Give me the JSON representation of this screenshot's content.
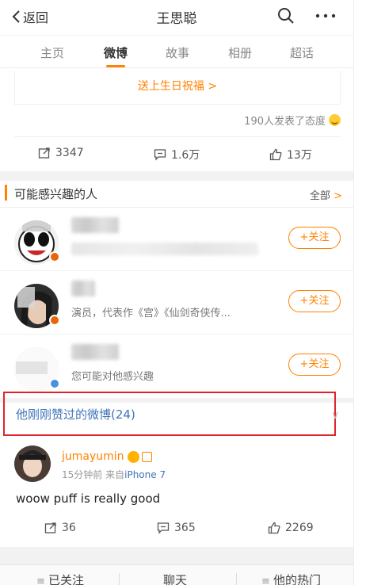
{
  "nav": {
    "back_label": "返回",
    "title": "王思聪"
  },
  "tabs": [
    {
      "label": "主页"
    },
    {
      "label": "微博"
    },
    {
      "label": "故事"
    },
    {
      "label": "相册"
    },
    {
      "label": "超话"
    }
  ],
  "birthday": {
    "label": "送上生日祝福 >"
  },
  "attitude": {
    "text": "190人发表了态度"
  },
  "actions": {
    "repost": "3347",
    "comment": "1.6万",
    "like": "13万"
  },
  "people": {
    "title": "可能感兴趣的人",
    "all_label": "全部",
    "all_arrow": ">",
    "items": [
      {
        "desc": "",
        "follow_label": "+关注",
        "badge_color": "#e8650a"
      },
      {
        "desc": "演员，代表作《宫》《仙剑奇侠传...",
        "follow_label": "+关注",
        "badge_color": "#e8650a"
      },
      {
        "desc": "您可能对他感兴趣",
        "follow_label": "+关注",
        "badge_color": "#4a90e2"
      }
    ]
  },
  "liked": {
    "title": "他刚刚赞过的微博(24)",
    "chevron": "∨"
  },
  "post": {
    "username": "jumayumin",
    "time": "15分钟前",
    "source_prefix": "来自",
    "source": "iPhone 7",
    "text": "woow puff is really good",
    "repost": "36",
    "comment": "365",
    "like": "2269"
  },
  "bottom": {
    "followed": "已关注",
    "chat": "聊天",
    "hot": "他的热门"
  },
  "colors": {
    "accent": "#ff8200",
    "link": "#3f74b8",
    "highlight": "#e0242a"
  }
}
